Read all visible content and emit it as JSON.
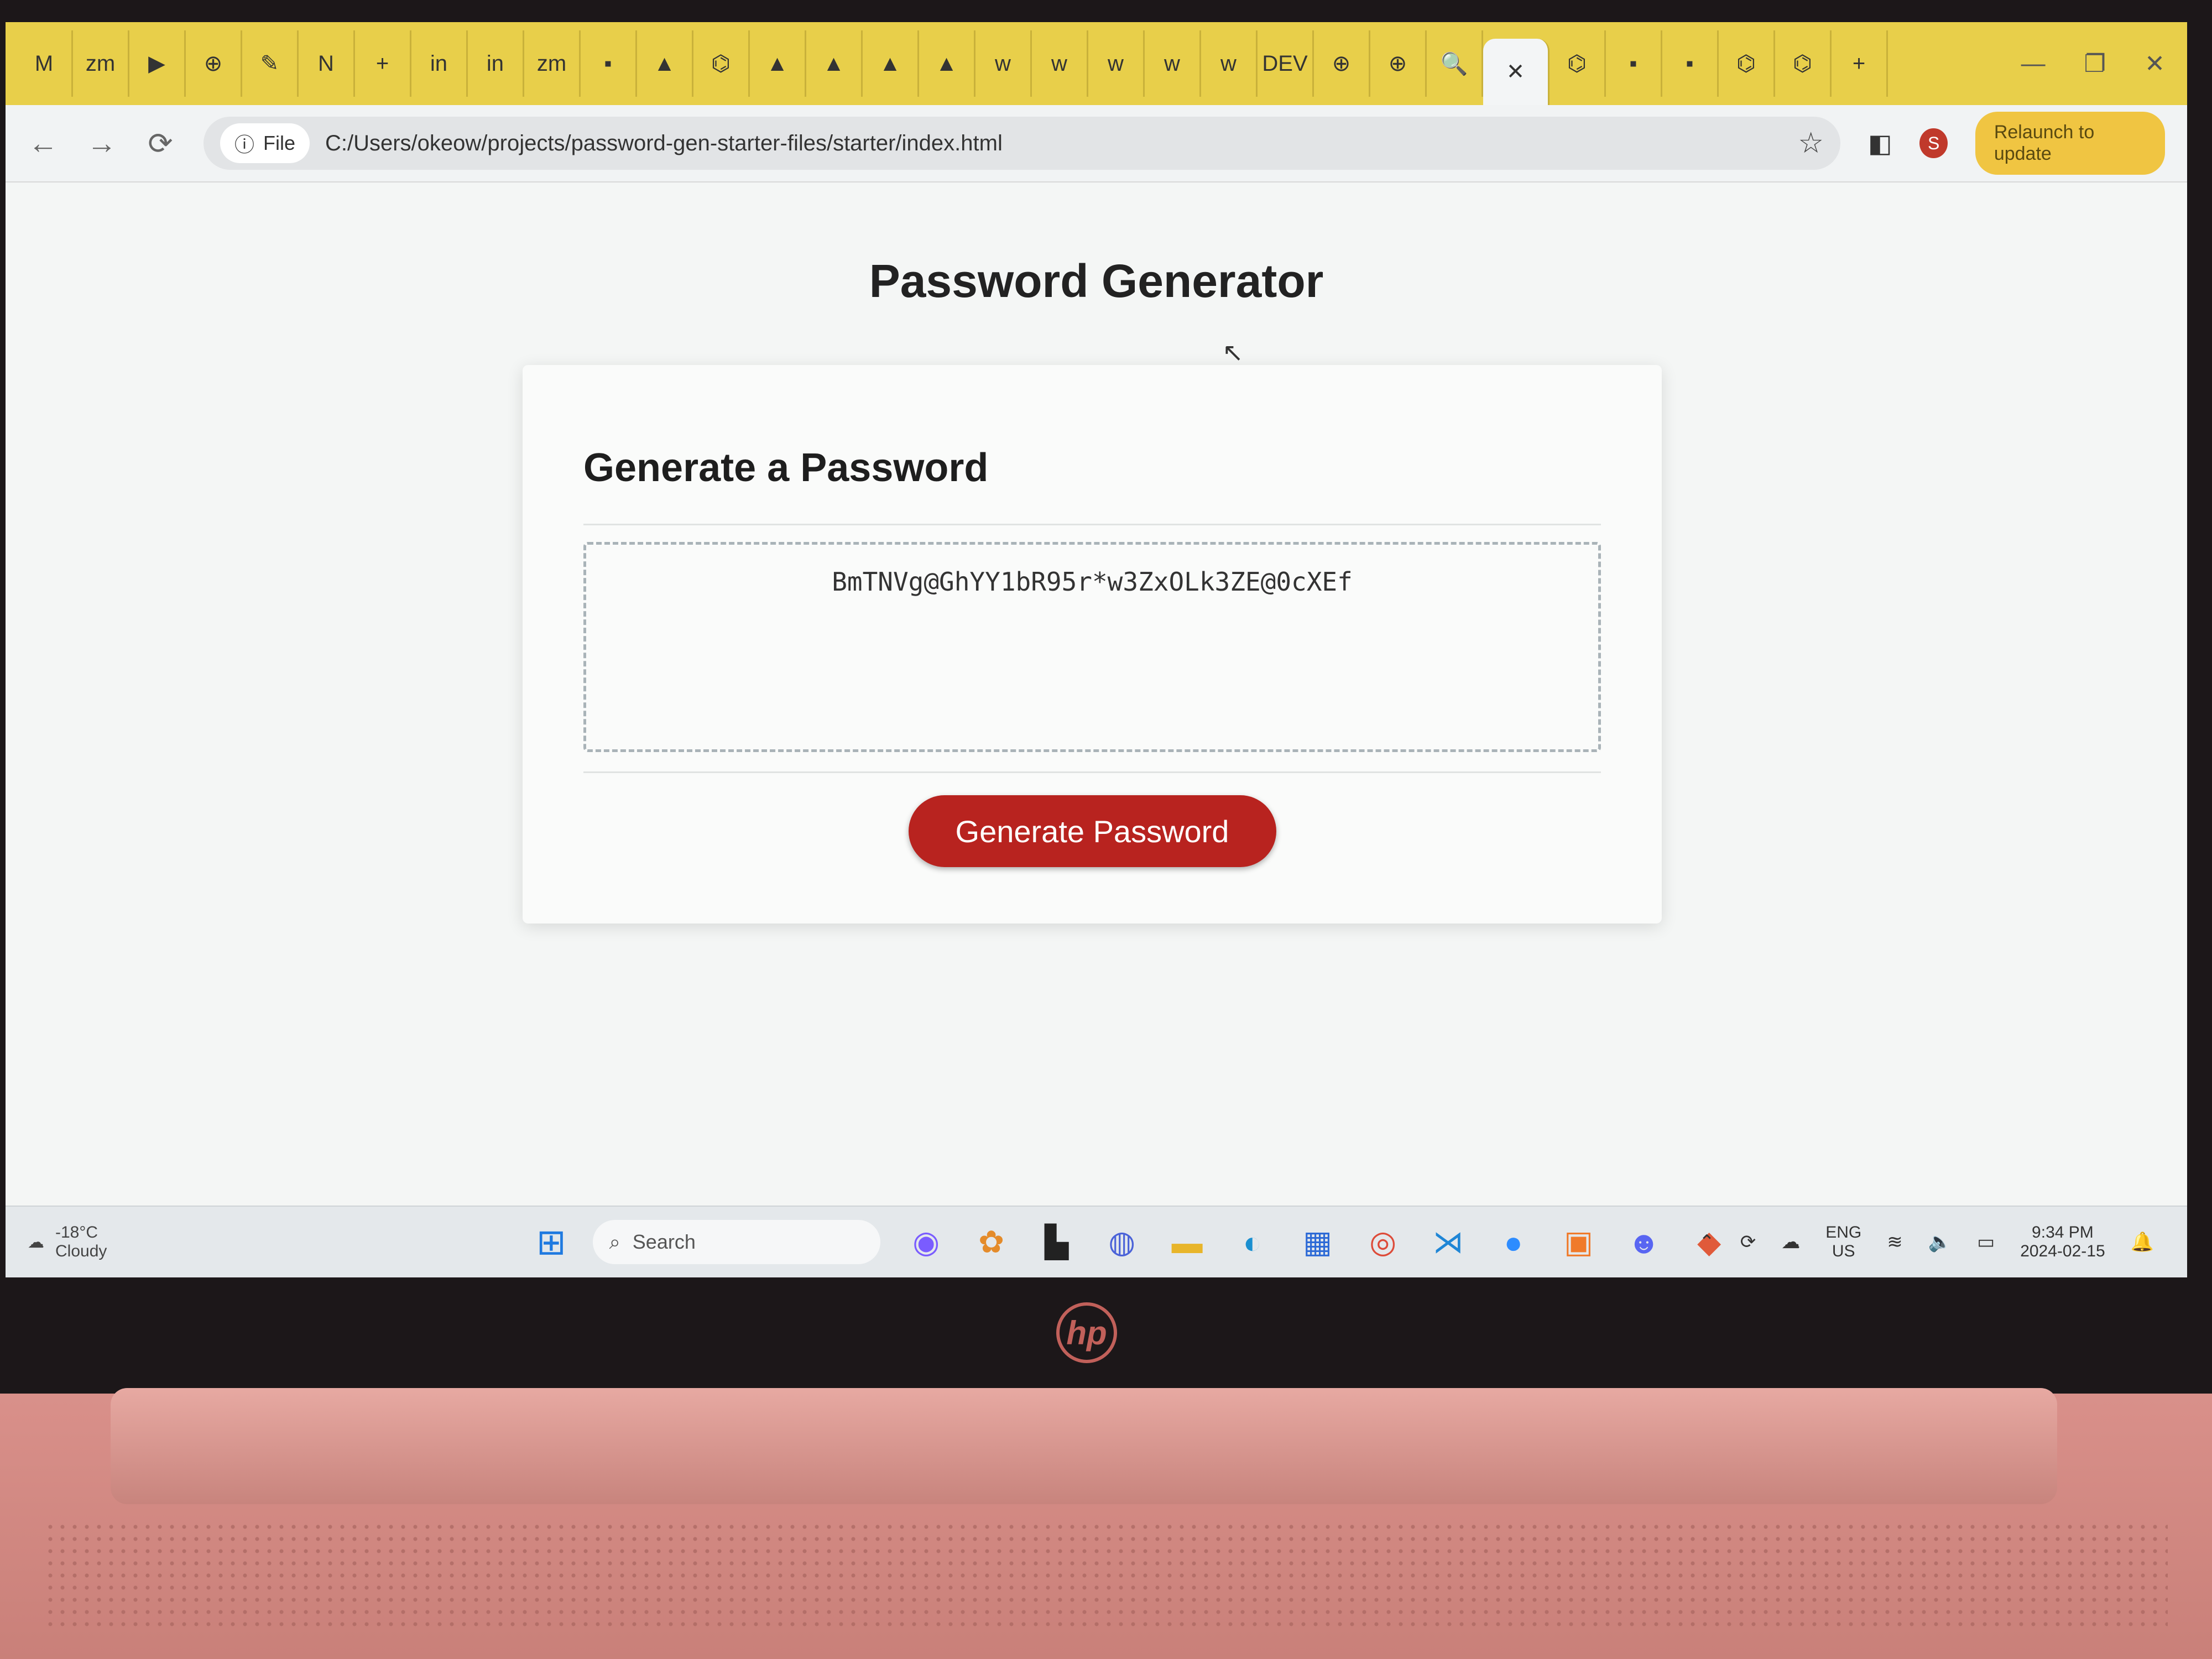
{
  "browser": {
    "tabs": [
      "M",
      "zm",
      "▶",
      "⊕",
      "✎",
      "N",
      "+",
      "in",
      "in",
      "zm",
      "▪",
      "▲",
      "⌬",
      "▲",
      "▲",
      "▲",
      "▲",
      "w",
      "w",
      "w",
      "w",
      "w",
      "DEV",
      "⊕",
      "⊕",
      "🔍",
      "✕",
      "⌬",
      "▪",
      "▪",
      "⌬",
      "⌬",
      "+"
    ],
    "window_controls": [
      "—",
      "❐",
      "✕"
    ],
    "nav": {
      "back": "←",
      "forward": "→",
      "reload": "⟳"
    },
    "address_chip": "File",
    "url": "C:/Users/okeow/projects/password-gen-starter-files/starter/index.html",
    "profile_initial": "S",
    "relaunch_label": "Relaunch to update"
  },
  "page": {
    "title": "Password Generator",
    "card_title": "Generate a Password",
    "password": "BmTNVg@GhYY1bR95r*w3ZxOLk3ZE@0cXEf",
    "button_label": "Generate Password"
  },
  "taskbar": {
    "temperature": "-18°C",
    "weather": "Cloudy",
    "search_placeholder": "Search",
    "language": "ENG",
    "region": "US",
    "time": "9:34 PM",
    "date": "2024-02-15"
  },
  "laptop": {
    "logo": "hp"
  }
}
